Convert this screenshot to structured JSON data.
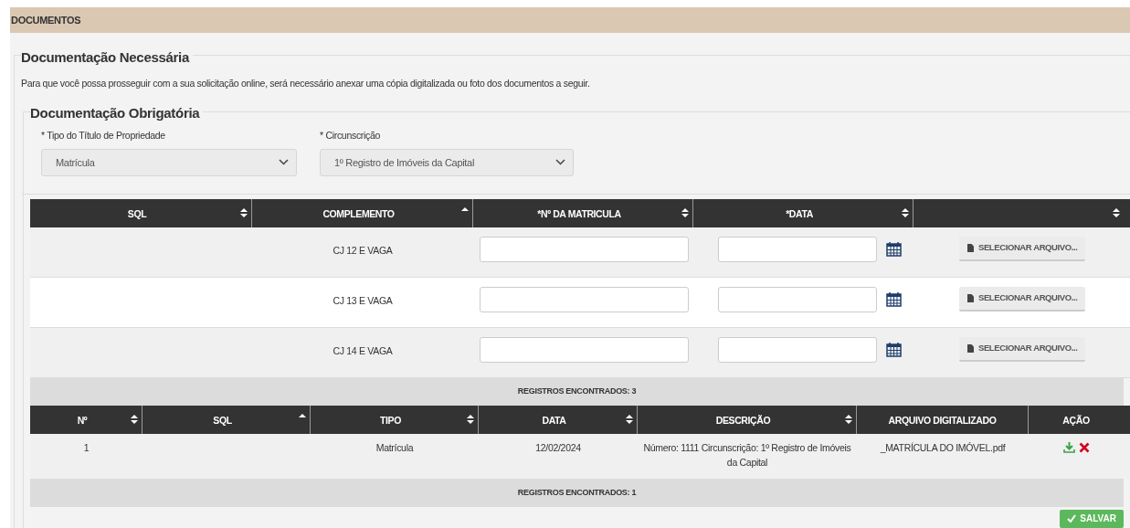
{
  "header": {
    "title": "DOCUMENTOS"
  },
  "section": {
    "title": "Documentação Necessária",
    "description": "Para que você possa prosseguir com a sua solicitação online, será necessário anexar uma cópia digitalizada ou foto dos documentos a seguir."
  },
  "subsection": {
    "title": "Documentação Obrigatória"
  },
  "fields": [
    {
      "label": "* Tipo do Título de Propriedade",
      "value": "Matrícula"
    },
    {
      "label": "* Circunscrição",
      "value": "1º Registro de Imóveis da Capital"
    }
  ],
  "upload_table": {
    "columns": [
      {
        "label": "SQL",
        "kind": "sortable"
      },
      {
        "label": "COMPLEMENTO",
        "kind": "sorted"
      },
      {
        "label": "*Nº DA MATRICULA",
        "kind": "sortable"
      },
      {
        "label": "*DATA",
        "kind": "sortable"
      },
      {
        "kind": "sortable"
      }
    ],
    "rows": [
      {
        "complemento": "CJ 12 E VAGA",
        "button": "SELECIONAR ARQUIVO..."
      },
      {
        "complemento": "CJ 13 E VAGA",
        "button": "SELECIONAR ARQUIVO..."
      },
      {
        "complemento": "CJ 14 E VAGA",
        "button": "SELECIONAR ARQUIVO..."
      }
    ],
    "footer": "REGISTROS ENCONTRADOS: 3"
  },
  "files_table": {
    "columns": [
      {
        "label": "Nº",
        "kind": "sortable"
      },
      {
        "label": "SQL",
        "kind": "sorted"
      },
      {
        "label": "TIPO",
        "kind": "sortable"
      },
      {
        "label": "DATA",
        "kind": "sortable"
      },
      {
        "label": "DESCRIÇÃO",
        "kind": "sortable"
      },
      {
        "label": "ARQUIVO DIGITALIZADO",
        "kind": "plain"
      },
      {
        "label": "AÇÃO",
        "kind": "plain"
      }
    ],
    "rows": [
      {
        "numero": "1",
        "tipo": "Matrícula",
        "data": "12/02/2024",
        "descricao": "Número: 1111 Circunscrição: 1º Registro de Imóveis da Capital",
        "arquivo": "_MATRÍCULA DO IMÓVEL.pdf"
      }
    ],
    "footer": "REGISTROS ENCONTRADOS: 1"
  },
  "save_button": "SALVAR"
}
